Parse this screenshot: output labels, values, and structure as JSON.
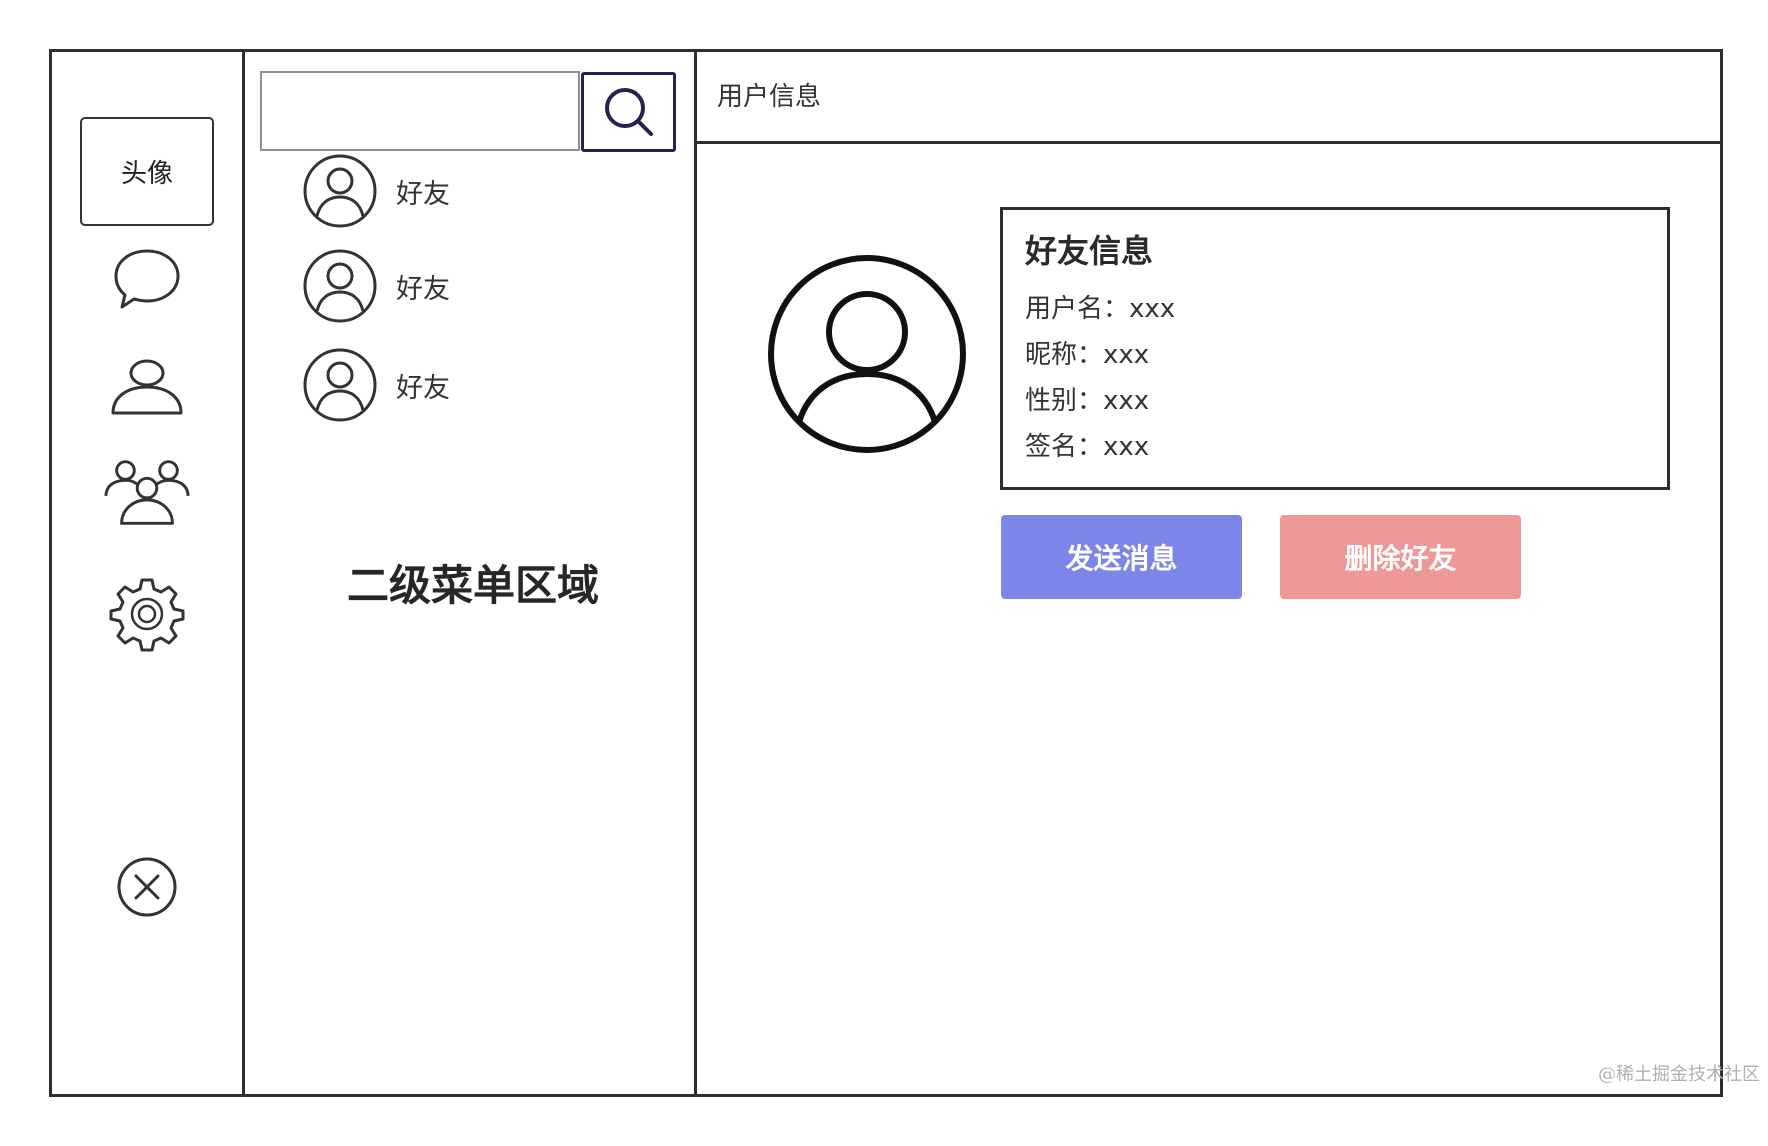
{
  "colors": {
    "frame": "#2e2e2e",
    "send_button": "#7b86e8",
    "delete_button": "#ef9898",
    "search_button_border": "#23234f"
  },
  "nav": {
    "avatar_label": "头像",
    "items": [
      {
        "icon": "chat-bubble-icon"
      },
      {
        "icon": "user-icon"
      },
      {
        "icon": "group-icon"
      },
      {
        "icon": "gear-icon"
      }
    ],
    "close_icon": "close-circle-icon"
  },
  "menu": {
    "search": {
      "value": "",
      "placeholder": "",
      "icon": "search-icon"
    },
    "friends": [
      {
        "label": "好友",
        "icon": "user-circle-icon"
      },
      {
        "label": "好友",
        "icon": "user-circle-icon"
      },
      {
        "label": "好友",
        "icon": "user-circle-icon"
      }
    ],
    "caption": "二级菜单区域"
  },
  "main": {
    "title": "用户信息",
    "avatar_icon": "user-circle-icon",
    "card": {
      "title": "好友信息",
      "rows": [
        {
          "text": "用户名：xxx"
        },
        {
          "text": "昵称：xxx"
        },
        {
          "text": "性别：xxx"
        },
        {
          "text": "签名：xxx"
        }
      ]
    },
    "buttons": {
      "send": "发送消息",
      "delete": "删除好友"
    }
  },
  "watermark": "@稀土掘金技术社区"
}
